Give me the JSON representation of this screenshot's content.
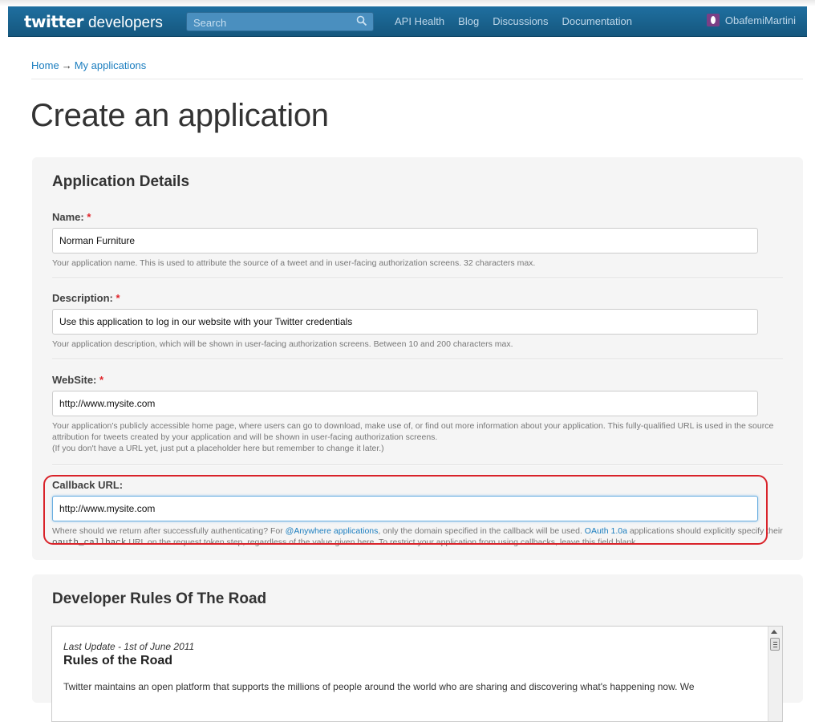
{
  "navbar": {
    "brand_word": "twitter",
    "brand_suffix": "developers",
    "search_placeholder": "Search",
    "links": [
      "API Health",
      "Blog",
      "Discussions",
      "Documentation"
    ],
    "username": "ObafemiMartini"
  },
  "breadcrumb": {
    "home": "Home",
    "separator": "→",
    "current": "My applications"
  },
  "page_title": "Create an application",
  "details": {
    "title": "Application Details",
    "required_mark": "*",
    "name": {
      "label": "Name:",
      "value": "Norman Furniture",
      "help": "Your application name. This is used to attribute the source of a tweet and in user-facing authorization screens. 32 characters max."
    },
    "description": {
      "label": "Description:",
      "value": "Use this application to log in our website with your Twitter credentials",
      "help": "Your application description, which will be shown in user-facing authorization screens. Between 10 and 200 characters max."
    },
    "website": {
      "label": "WebSite:",
      "value": "http://www.mysite.com",
      "help_line1": "Your application's publicly accessible home page, where users can go to download, make use of, or find out more information about your application. This fully-qualified URL is used in the source attribution for tweets created by your application and will be shown in user-facing authorization screens.",
      "help_line2": "(If you don't have a URL yet, just put a placeholder here but remember to change it later.)"
    },
    "callback": {
      "label": "Callback URL:",
      "value": "http://www.mysite.com",
      "help_part1": "Where should we return after successfully authenticating? For ",
      "help_link1": "@Anywhere applications",
      "help_part2": ", only the domain specified in the callback will be used. ",
      "help_link2": "OAuth 1.0a",
      "help_part3": " applications should explicitly specify their ",
      "help_code": "oauth_callback",
      "help_part4": " URL on the request token step, regardless of the value given here. To restrict your application from using callbacks, leave this field blank."
    }
  },
  "rules": {
    "title": "Developer Rules Of The Road",
    "updated": "Last Update - 1st of June 2011",
    "heading": "Rules of the Road",
    "body": "Twitter maintains an open platform that supports the millions of people around the world who are sharing and discovering what's happening now. We"
  },
  "colors": {
    "navbar": "#1f6fa0",
    "link": "#1a7dbf",
    "required": "#e0242a",
    "highlight": "#d9232a"
  },
  "icons": [
    "search-icon",
    "avatar"
  ]
}
